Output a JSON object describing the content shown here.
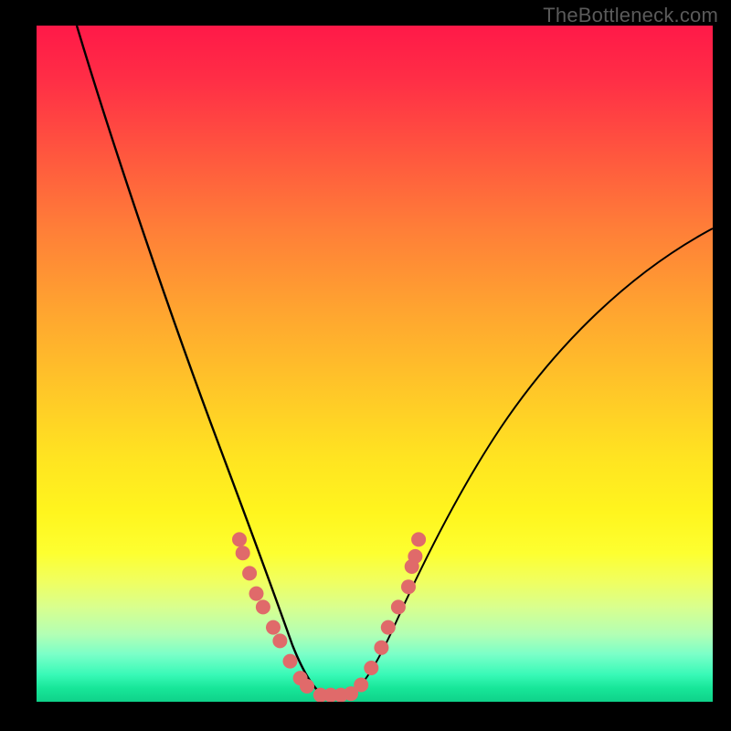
{
  "watermark": "TheBottleneck.com",
  "colors": {
    "background": "#000000",
    "curve": "#000000",
    "marker_fill": "#e06a6a",
    "marker_stroke": "#c94f4f",
    "plot_border": "#000000"
  },
  "chart_data": {
    "type": "line",
    "title": "",
    "xlabel": "",
    "ylabel": "",
    "xlim": [
      0,
      100
    ],
    "ylim": [
      0,
      100
    ],
    "grid": false,
    "legend": false,
    "series": [
      {
        "name": "bottleneck-curve-left",
        "x": [
          6,
          10,
          15,
          20,
          24,
          26,
          28,
          30,
          32,
          34,
          36,
          37.5,
          39,
          40.5,
          42
        ],
        "y": [
          100,
          88,
          72,
          55,
          41,
          35,
          29,
          24,
          18,
          13,
          9,
          6,
          4,
          2.2,
          1
        ]
      },
      {
        "name": "bottleneck-curve-right",
        "x": [
          46,
          48,
          50,
          52,
          55,
          58,
          62,
          68,
          75,
          82,
          90,
          100
        ],
        "y": [
          1,
          3,
          6,
          10,
          16,
          22,
          30,
          39,
          48,
          55,
          62,
          70
        ]
      }
    ],
    "markers": [
      {
        "x": 30,
        "y": 24
      },
      {
        "x": 30.5,
        "y": 22
      },
      {
        "x": 31.5,
        "y": 19
      },
      {
        "x": 32.5,
        "y": 16
      },
      {
        "x": 33.5,
        "y": 14
      },
      {
        "x": 35,
        "y": 11
      },
      {
        "x": 36,
        "y": 9
      },
      {
        "x": 37.5,
        "y": 6
      },
      {
        "x": 39,
        "y": 3.5
      },
      {
        "x": 40,
        "y": 2.3
      },
      {
        "x": 42,
        "y": 1
      },
      {
        "x": 43.5,
        "y": 1
      },
      {
        "x": 45,
        "y": 1
      },
      {
        "x": 46.5,
        "y": 1.2
      },
      {
        "x": 48,
        "y": 2.5
      },
      {
        "x": 49.5,
        "y": 5
      },
      {
        "x": 51,
        "y": 8
      },
      {
        "x": 52,
        "y": 11
      },
      {
        "x": 53.5,
        "y": 14
      },
      {
        "x": 55,
        "y": 17
      },
      {
        "x": 55.5,
        "y": 20
      },
      {
        "x": 56,
        "y": 21.5
      },
      {
        "x": 56.5,
        "y": 24
      }
    ]
  }
}
